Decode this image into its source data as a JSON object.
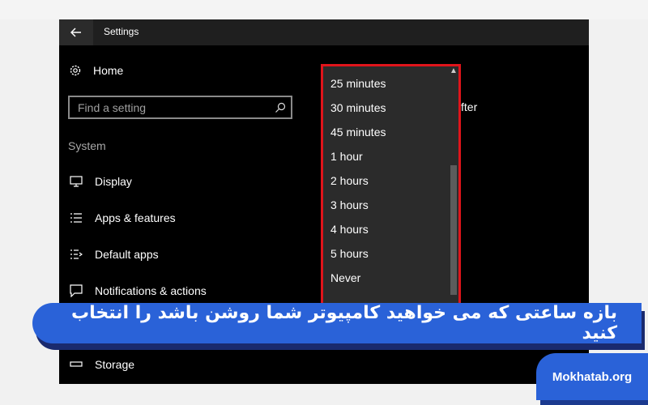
{
  "window": {
    "title": "Settings",
    "home_label": "Home",
    "search_placeholder": "Find a setting",
    "section_label": "System",
    "nav_items": [
      {
        "label": "Display",
        "icon": "monitor-icon"
      },
      {
        "label": "Apps & features",
        "icon": "list-icon"
      },
      {
        "label": "Default apps",
        "icon": "default-apps-icon"
      },
      {
        "label": "Notifications & actions",
        "icon": "notification-icon"
      },
      {
        "label": "Storage",
        "icon": "storage-icon"
      }
    ],
    "partial_right_text": "fter"
  },
  "dropdown": {
    "options": [
      "25 minutes",
      "30 minutes",
      "45 minutes",
      "1 hour",
      "2 hours",
      "3 hours",
      "4 hours",
      "5 hours",
      "Never"
    ]
  },
  "banner": {
    "text": "بازه ساعتی که می خواهید کامپیوتر شما روشن باشد را انتخاب کنید"
  },
  "brand": {
    "text": "Mokhatab.org"
  },
  "colors": {
    "highlight_border": "#e0141b",
    "banner_blue": "#2a62d8",
    "window_bg": "#000000"
  }
}
